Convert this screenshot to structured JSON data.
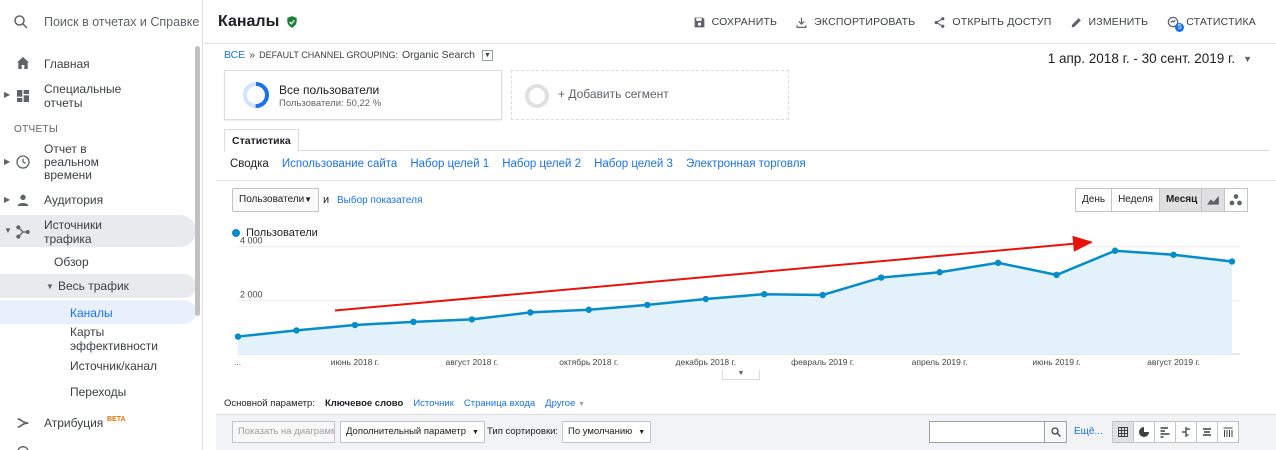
{
  "sidebar": {
    "search_placeholder": "Поиск в отчетах и Справке",
    "home": "Главная",
    "custom_reports": [
      "Специальные",
      "отчеты"
    ],
    "section_reports": "ОТЧЕТЫ",
    "realtime": [
      "Отчет в",
      "реальном",
      "времени"
    ],
    "audience": "Аудитория",
    "acquisition": [
      "Источники",
      "трафика"
    ],
    "overview": "Обзор",
    "all_traffic": "Весь трафик",
    "channels": "Каналы",
    "treemaps": [
      "Карты",
      "эффективности"
    ],
    "source_medium": "Источник/канал",
    "referrals": "Переходы",
    "attribution": "Атрибуция",
    "attribution_badge": "BETA"
  },
  "header": {
    "title": "Каналы",
    "actions": {
      "save": "СОХРАНИТЬ",
      "export": "ЭКСПОРТИРОВАТЬ",
      "share": "ОТКРЫТЬ ДОСТУП",
      "edit": "ИЗМЕНИТЬ",
      "insights": "СТАТИСТИКА",
      "insights_badge": "5"
    }
  },
  "breadcrumb": {
    "all": "ВСЕ",
    "sep": "»",
    "grouping": "DEFAULT CHANNEL GROUPING:",
    "value": "Organic Search"
  },
  "date_range": "1 апр. 2018 г. - 30 сент. 2019 г.",
  "segments": {
    "primary": {
      "name": "Все пользователи",
      "sub": "Пользователи: 50,22 %",
      "share": 0.5022
    },
    "add": "+ Добавить сегмент"
  },
  "tabs": {
    "active": "Статистика"
  },
  "subtabs": [
    "Сводка",
    "Использование сайта",
    "Набор целей 1",
    "Набор целей 2",
    "Набор целей 3",
    "Электронная торговля"
  ],
  "metric_controls": {
    "metric": "Пользователи",
    "and": "и",
    "pick": "Выбор показателя",
    "periods": [
      "День",
      "Неделя",
      "Месяц"
    ],
    "active_period": "Месяц"
  },
  "chart_data": {
    "type": "line",
    "series": [
      {
        "name": "Пользователи",
        "color": "#058dc7",
        "values": [
          650,
          880,
          1080,
          1200,
          1290,
          1550,
          1650,
          1830,
          2050,
          2230,
          2200,
          2850,
          3050,
          3400,
          2950,
          3850,
          3700,
          3450
        ]
      }
    ],
    "x": [
      "2018-04",
      "2018-05",
      "2018-06",
      "2018-07",
      "2018-08",
      "2018-09",
      "2018-10",
      "2018-11",
      "2018-12",
      "2019-01",
      "2019-02",
      "2019-03",
      "2019-04",
      "2019-05",
      "2019-06",
      "2019-07",
      "2019-08",
      "2019-09"
    ],
    "x_tick_labels": [
      "...",
      "июнь 2018 г.",
      "август 2018 г.",
      "октябрь 2018 г.",
      "декабрь 2018 г.",
      "февраль 2019 г.",
      "апрель 2019 г.",
      "июнь 2019 г.",
      "август 2019 г."
    ],
    "y_ticks": [
      "4 000",
      "2 000"
    ],
    "y_tick_values": [
      4000,
      2000
    ],
    "ylim": [
      0,
      4400
    ],
    "legend": "Пользователи",
    "legend_position": "top-left",
    "area_fill": "#e3f1fa",
    "annotation": {
      "type": "arrow",
      "color": "#e8120c",
      "from": {
        "x": "2018-06",
        "y": 1620
      },
      "to": {
        "x": "2019-07",
        "y": 4170
      }
    }
  },
  "dimensions": {
    "label": "Основной параметр:",
    "current": "Ключевое слово",
    "others": [
      "Источник",
      "Страница входа"
    ],
    "more": "Другое"
  },
  "table_toolbar": {
    "plot_rows": "Показать на диаграмме",
    "secondary": "Дополнительный параметр",
    "sort_label": "Тип сортировки:",
    "sort_value": "По умолчанию",
    "more": "Ещё..."
  }
}
